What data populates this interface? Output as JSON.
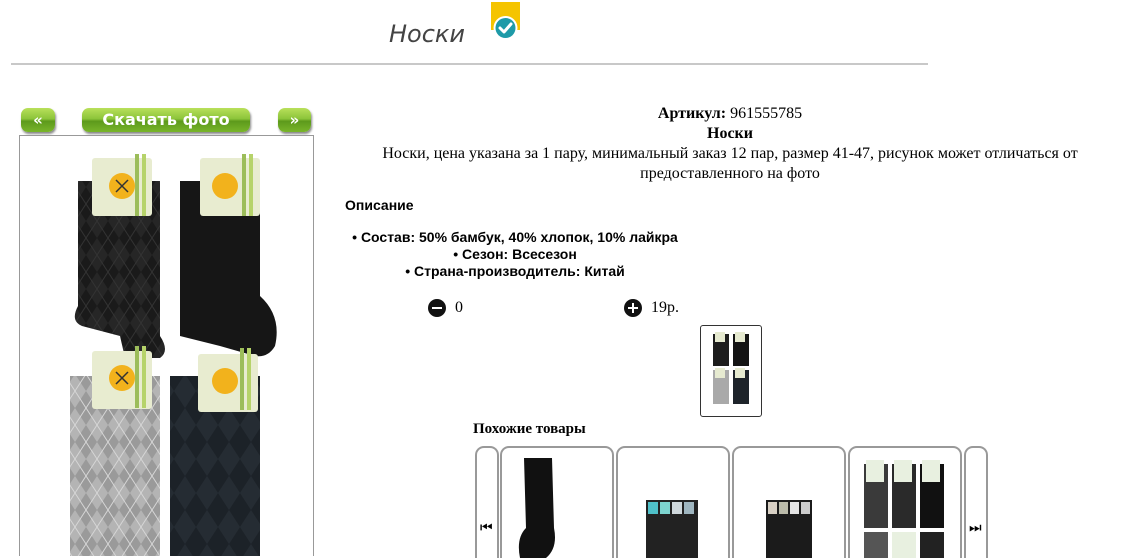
{
  "header": {
    "title": "Носки"
  },
  "gallery": {
    "prev_label": "«",
    "download_label": "Скачать фото",
    "next_label": "»"
  },
  "product": {
    "article_label": "Артикул:",
    "article_value": "961555785",
    "name": "Носки",
    "summary": "Носки, цена указана за 1 пару, минимальный заказ 12 пар, размер 41-47, рисунок может отличаться от предоставленного на фото",
    "description_heading": "Описание",
    "specs": [
      "Состав: 50% бамбук, 40% хлопок, 10% лайкра",
      "Сезон: Всесезон",
      "Страна-производитель: Китай"
    ],
    "quantity": "0",
    "price": "19р."
  },
  "similar": {
    "heading": "Похожие товары"
  },
  "colors": {
    "accent_green": "#8cc43a",
    "badge_yellow": "#f5c400",
    "check_teal": "#1e9aa8"
  }
}
